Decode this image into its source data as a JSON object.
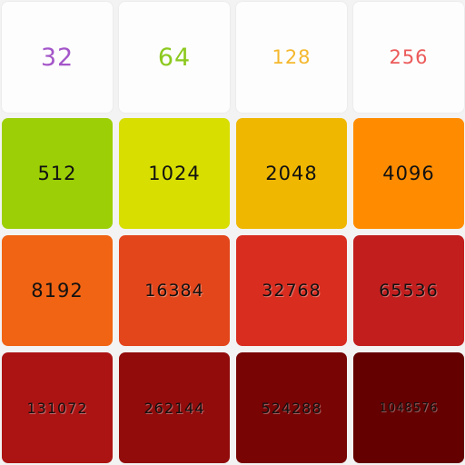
{
  "board": {
    "tiles": [
      {
        "value": "32",
        "bg": "#fdfdfd",
        "color": "#a456c9"
      },
      {
        "value": "64",
        "bg": "#fdfdfd",
        "color": "#8cc91f"
      },
      {
        "value": "128",
        "bg": "#fdfdfd",
        "color": "#f5b82e"
      },
      {
        "value": "256",
        "bg": "#fdfdfd",
        "color": "#ec5a5a"
      },
      {
        "value": "512",
        "bg": "#9ccf06",
        "color": "#111111"
      },
      {
        "value": "1024",
        "bg": "#d7de00",
        "color": "#111111"
      },
      {
        "value": "2048",
        "bg": "#efb700",
        "color": "#111111"
      },
      {
        "value": "4096",
        "bg": "#ff8c00",
        "color": "#111111"
      },
      {
        "value": "8192",
        "bg": "#f06413",
        "color": "#111111"
      },
      {
        "value": "16384",
        "bg": "#e3461b",
        "color": "#111111"
      },
      {
        "value": "32768",
        "bg": "#d92d20",
        "color": "#111111"
      },
      {
        "value": "65536",
        "bg": "#c21e1e",
        "color": "#111111"
      },
      {
        "value": "131072",
        "bg": "#ac1414",
        "color": "#111111"
      },
      {
        "value": "262144",
        "bg": "#920c0c",
        "color": "#111111"
      },
      {
        "value": "524288",
        "bg": "#790404",
        "color": "#111111"
      },
      {
        "value": "1048576",
        "bg": "#640000",
        "color": "#111111"
      }
    ]
  }
}
